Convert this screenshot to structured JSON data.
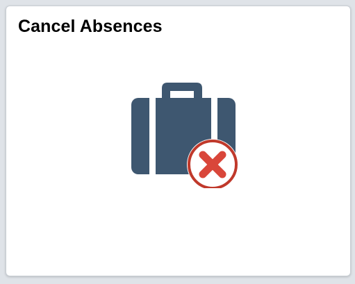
{
  "tile": {
    "title": "Cancel Absences",
    "icon": "briefcase-cancel-icon"
  },
  "colors": {
    "briefcase": "#3e5770",
    "cancel_ring": "#c0392b",
    "cancel_x": "#d9463a",
    "tile_background": "#ffffff",
    "page_background": "#dfe3e8"
  }
}
